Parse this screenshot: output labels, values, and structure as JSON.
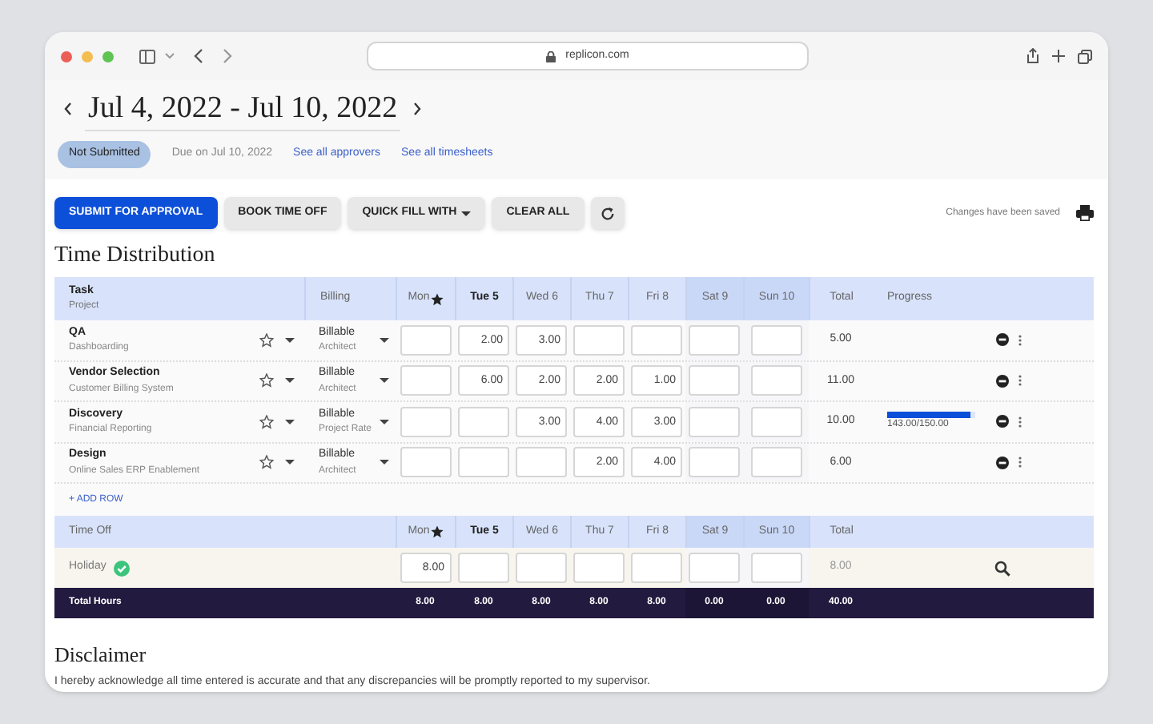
{
  "browser": {
    "url": "replicon.com"
  },
  "period": {
    "title": "Jul 4, 2022 - Jul 10, 2022"
  },
  "status": {
    "badge": "Not Submitted",
    "due": "Due on Jul 10, 2022",
    "links": [
      "See all approvers",
      "See all timesheets"
    ]
  },
  "toolbar": {
    "buttons": [
      {
        "kind": "primary",
        "label": "SUBMIT FOR APPROVAL"
      },
      {
        "kind": "plain",
        "label": "BOOK TIME OFF"
      },
      {
        "kind": "dropdown",
        "label": "QUICK FILL WITH"
      },
      {
        "kind": "plain",
        "label": "CLEAR ALL"
      },
      {
        "kind": "refresh"
      }
    ],
    "saved_note": "Changes have been saved"
  },
  "section_title": "Time Distribution",
  "table": {
    "columns": {
      "task": "Task",
      "project": "Project",
      "billing": "Billing",
      "days": [
        {
          "label": "Mon",
          "holiday": true,
          "current": false,
          "weekend": false
        },
        {
          "label": "Tue 5",
          "holiday": false,
          "current": true,
          "weekend": false
        },
        {
          "label": "Wed 6",
          "holiday": false,
          "current": false,
          "weekend": false
        },
        {
          "label": "Thu 7",
          "holiday": false,
          "current": false,
          "weekend": false
        },
        {
          "label": "Fri 8",
          "holiday": false,
          "current": false,
          "weekend": false
        },
        {
          "label": "Sat 9",
          "holiday": false,
          "current": false,
          "weekend": true
        },
        {
          "label": "Sun 10",
          "holiday": false,
          "current": false,
          "weekend": true
        }
      ],
      "total": "Total",
      "progress": "Progress"
    },
    "rows": [
      {
        "task": "QA",
        "project": "Dashboarding",
        "starred": false,
        "billing": "Billable",
        "rate": "Architect",
        "hours": {
          "tue": "2.00",
          "wed": "3.00"
        },
        "total": "5.00"
      },
      {
        "task": "Vendor Selection",
        "project": "Customer Billing System",
        "starred": false,
        "billing": "Billable",
        "rate": "Architect",
        "hours": {
          "tue": "6.00",
          "wed": "2.00",
          "thu": "2.00",
          "fri": "1.00"
        },
        "total": "11.00"
      },
      {
        "task": "Discovery",
        "project": "Financial Reporting",
        "starred": false,
        "billing": "Billable",
        "rate": "Project Rate",
        "hours": {
          "wed": "3.00",
          "thu": "4.00",
          "fri": "3.00"
        },
        "total": "10.00",
        "progress": {
          "level": 0.953,
          "reading": "143.00/150.00"
        }
      },
      {
        "task": "Design",
        "project": "Online Sales ERP Enablement",
        "starred": false,
        "billing": "Billable",
        "rate": "Architect",
        "hours": {
          "thu": "2.00",
          "fri": "4.00"
        },
        "total": "6.00"
      }
    ],
    "add_row": "+ ADD ROW"
  },
  "time_off": {
    "columns": {
      "label": "Time Off",
      "days": [
        {
          "label": "Mon",
          "holiday": true,
          "current": false,
          "weekend": false
        },
        {
          "label": "Tue 5",
          "holiday": false,
          "current": true,
          "weekend": false
        },
        {
          "label": "Wed 6",
          "holiday": false,
          "current": false,
          "weekend": false
        },
        {
          "label": "Thu 7",
          "holiday": false,
          "current": false,
          "weekend": false
        },
        {
          "label": "Fri 8",
          "holiday": false,
          "current": false,
          "weekend": false
        },
        {
          "label": "Sat 9",
          "holiday": false,
          "current": false,
          "weekend": true
        },
        {
          "label": "Sun 10",
          "holiday": false,
          "current": false,
          "weekend": true
        }
      ],
      "total": "Total"
    },
    "rows": [
      {
        "label": "Holiday",
        "approved": true,
        "hours": {
          "mon": "8.00"
        },
        "total": "8.00"
      }
    ]
  },
  "totals": {
    "label": "Total Hours",
    "hours": [
      "8.00",
      "8.00",
      "8.00",
      "8.00",
      "8.00",
      "0.00",
      "0.00"
    ],
    "total": "40.00"
  },
  "disclaimer": {
    "title": "Disclaimer",
    "text": "I hereby acknowledge all time entered is accurate and that any discrepancies will be promptly reported to my supervisor."
  }
}
